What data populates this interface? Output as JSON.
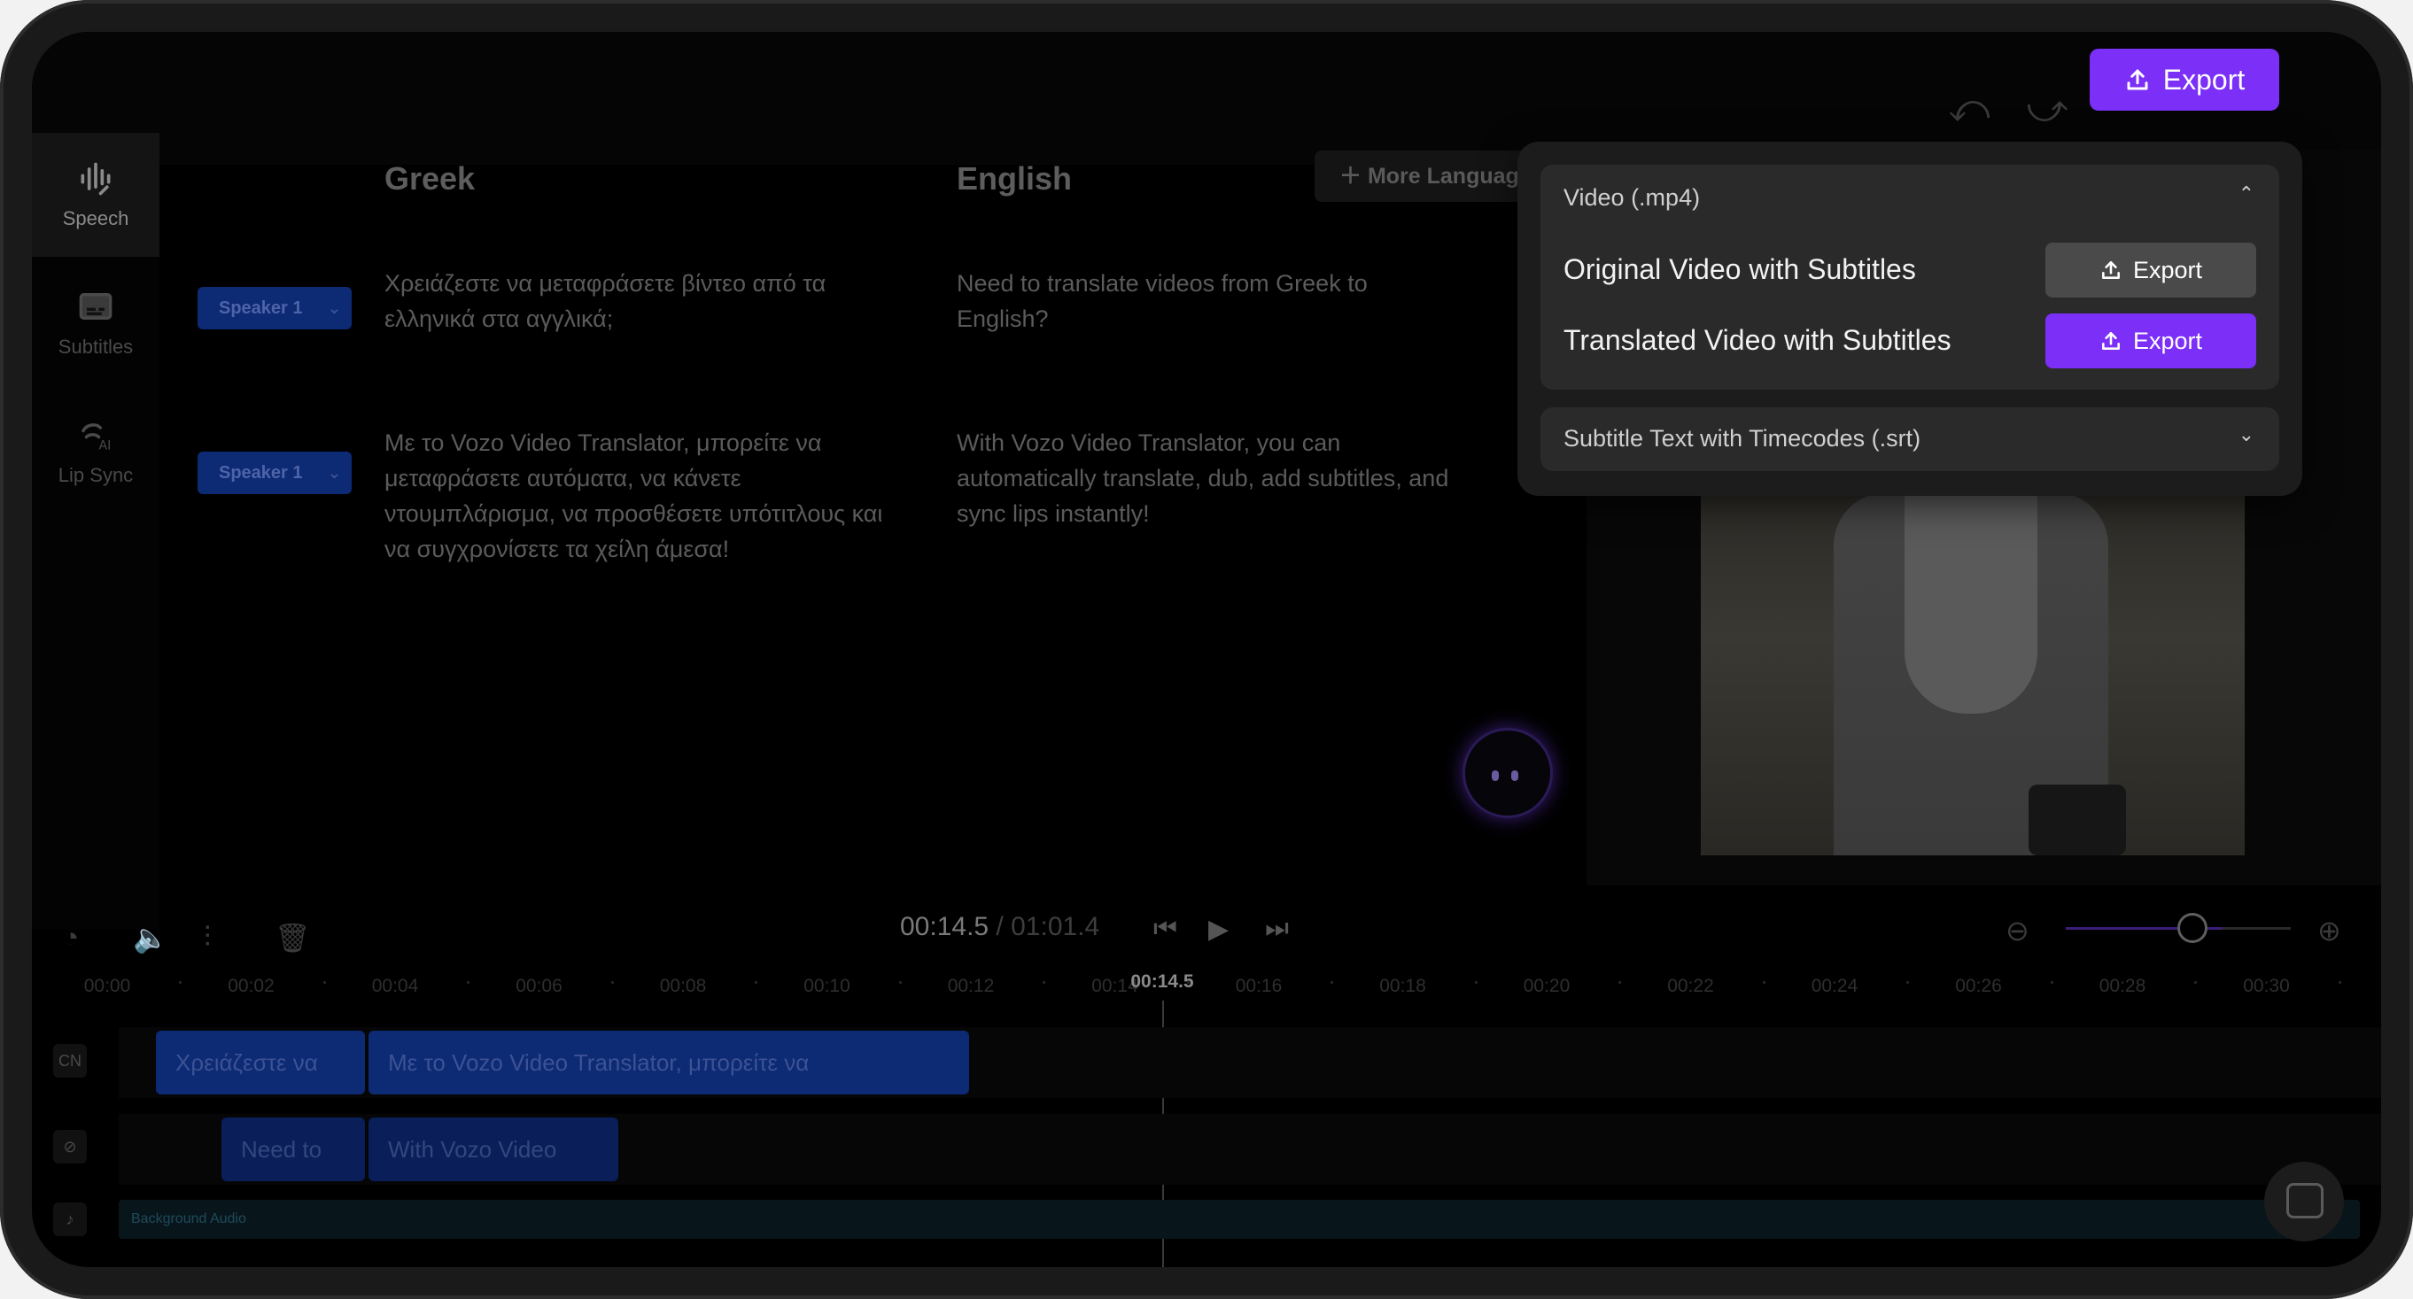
{
  "toolbar": {
    "export_label": "Export"
  },
  "nav": [
    {
      "label": "Speech",
      "icon": "waveform-icon"
    },
    {
      "label": "Subtitles",
      "icon": "subtitles-icon"
    },
    {
      "label": "Lip Sync",
      "icon": "lip-sync-ai-icon"
    }
  ],
  "languages": {
    "source": "Greek",
    "target": "English",
    "more_button": "More Languages"
  },
  "segments": [
    {
      "speaker": "Speaker 1",
      "source": "Χρειάζεστε να μεταφράσετε βίντεο από τα ελληνικά στα αγγλικά;",
      "target": "Need to translate videos from Greek to English?"
    },
    {
      "speaker": "Speaker 1",
      "source": "Με το Vozo Video Translator, μπορείτε να μεταφράσετε αυτόματα, να κάνετε ντουμπλάρισμα, να προσθέσετε υπότιτλους και να συγχρονίσετε τα χείλη άμεσα!",
      "target": "With Vozo Video Translator, you can automatically translate, dub, add subtitles, and sync lips instantly!"
    }
  ],
  "export_popup": {
    "video_section": "Video (.mp4)",
    "options": [
      {
        "label": "Original Video with Subtitles",
        "button": "Export"
      },
      {
        "label": "Translated Video with Subtitles",
        "button": "Export"
      }
    ],
    "srt_section": "Subtitle Text with Timecodes (.srt)"
  },
  "player": {
    "current_time": "00:14.5",
    "separator": " / ",
    "total_time": "01:01.4",
    "zoom_level": 0.3
  },
  "timeline": {
    "ticks": [
      "00:00",
      "00:02",
      "00:04",
      "00:06",
      "00:08",
      "00:10",
      "00:12",
      "00:14",
      "00:16",
      "00:18",
      "00:20",
      "00:22",
      "00:24",
      "00:26",
      "00:28",
      "00:30"
    ],
    "playhead_label": "00:14.5",
    "track_labels": {
      "greek": "CN"
    },
    "greek_clips": [
      "Χρειάζεστε να",
      "Με το Vozo Video Translator, μπορείτε να"
    ],
    "english_clips": [
      "Need to",
      "With Vozo Video"
    ],
    "audio_label": "Background Audio"
  },
  "colors": {
    "accent": "#7b2ff7",
    "speaker_chip": "#0d2a74"
  }
}
